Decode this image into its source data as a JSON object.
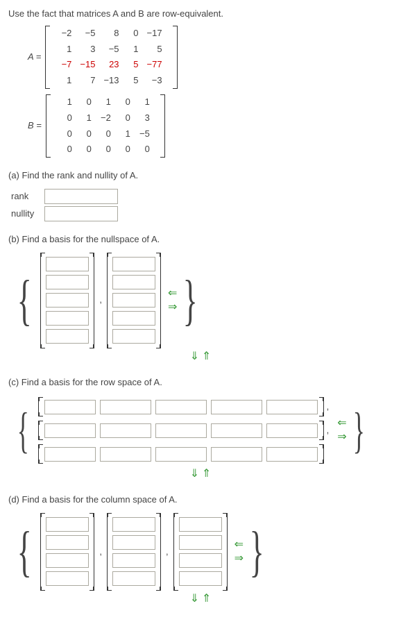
{
  "intro": "Use the fact that matrices A and B are row-equivalent.",
  "labels": {
    "A": "A =",
    "B": "B ="
  },
  "matrixA": [
    [
      "−2",
      "−5",
      "8",
      "0",
      "−17"
    ],
    [
      "1",
      "3",
      "−5",
      "1",
      "5"
    ],
    [
      "−7",
      "−15",
      "23",
      "5",
      "−77"
    ],
    [
      "1",
      "7",
      "−13",
      "5",
      "−3"
    ]
  ],
  "matrixB": [
    [
      "1",
      "0",
      "1",
      "0",
      "1"
    ],
    [
      "0",
      "1",
      "−2",
      "0",
      "3"
    ],
    [
      "0",
      "0",
      "0",
      "1",
      "−5"
    ],
    [
      "0",
      "0",
      "0",
      "0",
      "0"
    ]
  ],
  "parts": {
    "a": {
      "prompt": "(a) Find the rank and nullity of A.",
      "rank_label": "rank",
      "nullity_label": "nullity"
    },
    "b": {
      "prompt": "(b) Find a basis for the nullspace of A."
    },
    "c": {
      "prompt": "(c) Find a basis for the row space of A."
    },
    "d": {
      "prompt": "(d) Find a basis for the column space of A."
    }
  },
  "arrows": {
    "left": "⇐",
    "right": "⇒",
    "down": "⇓",
    "up": "⇑"
  },
  "comma": ","
}
